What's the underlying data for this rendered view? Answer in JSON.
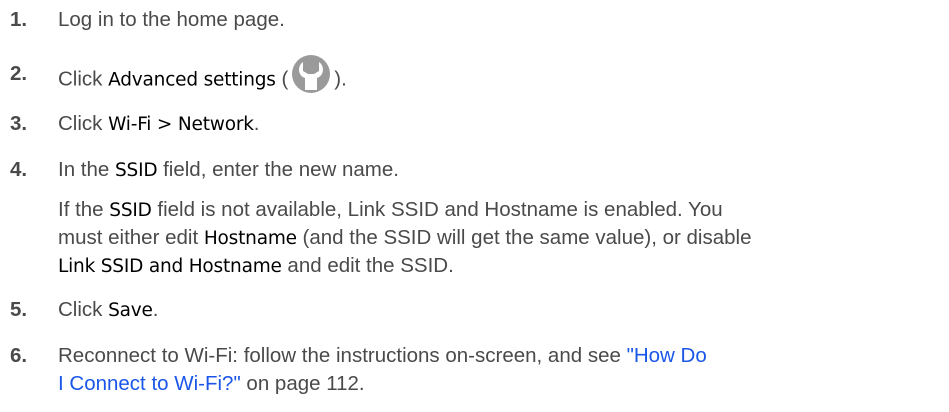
{
  "steps": [
    {
      "num": "1.",
      "text": "Log in to the home page."
    },
    {
      "num": "2.",
      "pre": "Click ",
      "ui": "Advanced settings",
      "open": " (",
      "icon": "wrench-settings-icon",
      "close": ")."
    },
    {
      "num": "3.",
      "pre": "Click ",
      "ui": "Wi-Fi > Network",
      "post": "."
    },
    {
      "num": "4.",
      "pre": "In the ",
      "ui": "SSID",
      "post": " field, enter the new name."
    },
    {
      "num": "5.",
      "pre": "Click ",
      "ui": "Save",
      "post": "."
    },
    {
      "num": "6.",
      "pre": "Reconnect to Wi-Fi: follow the instructions on-screen, and see ",
      "link_line1": "\"How Do",
      "link_line2": "I Connect to Wi-Fi?\"",
      "post": " on page 112."
    }
  ],
  "note": {
    "l1_pre": "If the ",
    "l1_ui": "SSID",
    "l1_post": " field is not available, Link SSID and Hostname is enabled. You",
    "l2_pre": "must either edit ",
    "l2_ui": "Hostname",
    "l2_post": " (and the SSID will get the same value), or disable",
    "l3_ui": "Link SSID and Hostname",
    "l3_post": " and edit the SSID."
  },
  "colors": {
    "text": "#4a4a4a",
    "ui_label": "#000000",
    "link": "#1a56e8",
    "icon_bg": "#9a9a9a"
  }
}
